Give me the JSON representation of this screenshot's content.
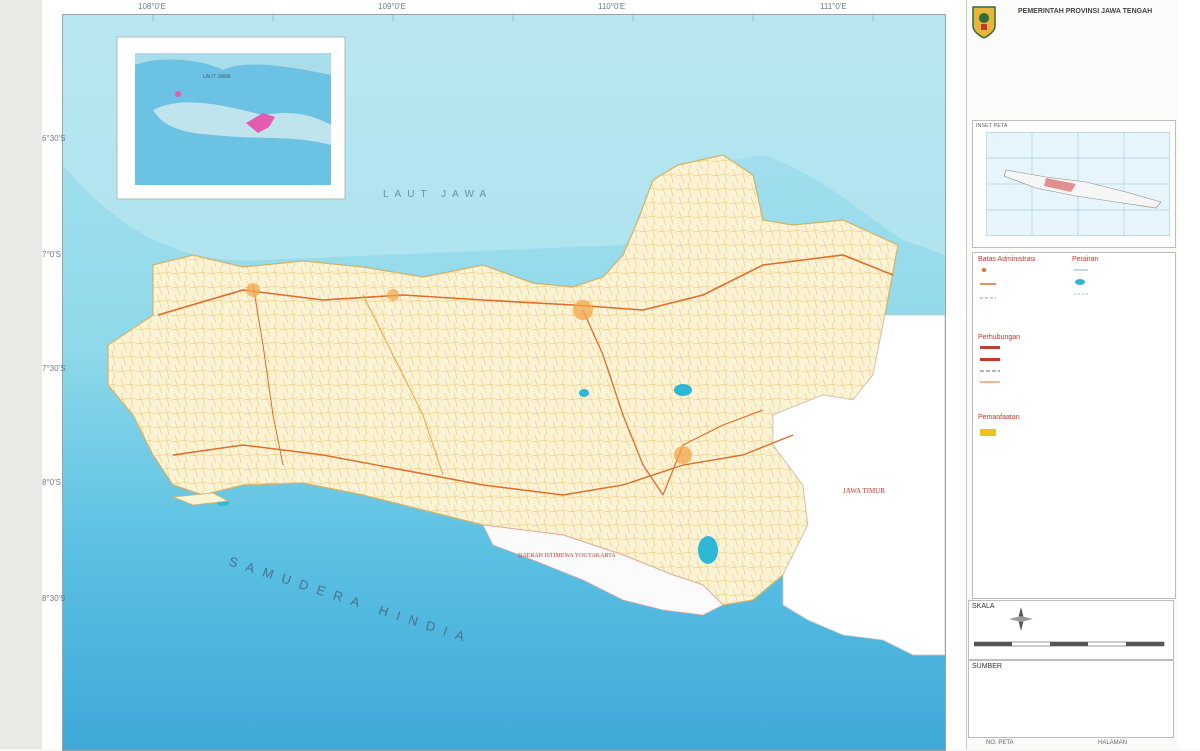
{
  "colors": {
    "sea": "#7fd3e6",
    "deep_sea": "#4fb7dc",
    "land": "#fdfbf0",
    "roads_primary": "#e06c2b",
    "roads_secondary": "#f0b43c",
    "lake": "#2fb7d6",
    "heading_red": "#c0392b"
  },
  "header": {
    "org": "PEMERINTAH PROVINSI JAWA TENGAH"
  },
  "map": {
    "sea_north": "LAUT JAWA",
    "ocean_south": "SAMUDERA HINDIA",
    "province_east": "JAWA TIMUR",
    "region_yogya": "DAERAH ISTIMEWA YOGYAKARTA",
    "top_ticks": [
      "108°0'E",
      "109°0'E",
      "110°0'E",
      "111°0'E"
    ],
    "left_ticks": [
      "6°30'S",
      "7°0'S",
      "7°30'S",
      "8°0'S",
      "8°30'S"
    ],
    "inset": {
      "label": "LAUT JAWA"
    }
  },
  "panel": {
    "index_map_label": "INSET PETA",
    "legend_heads": [
      "Batas Administrasi",
      "Perhubungan",
      "Perairan",
      "Pemanfaatan"
    ],
    "scale_head": "SKALA",
    "source_head": "SUMBER",
    "bottom_left": "NO. PETA",
    "bottom_right": "HALAMAN"
  }
}
